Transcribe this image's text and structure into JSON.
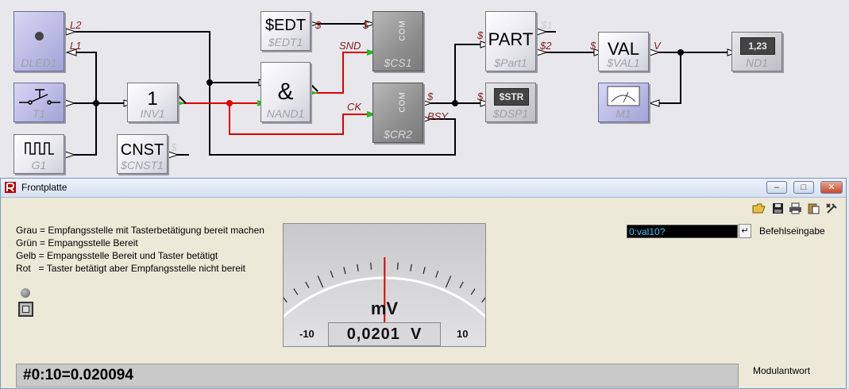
{
  "blocks": {
    "dled": {
      "name": "DLED1"
    },
    "t1": {
      "name": "T1"
    },
    "g1": {
      "name": "G1"
    },
    "inv": {
      "text": "1",
      "name": "INV1"
    },
    "cnst": {
      "text": "CNST",
      "name": "$CNST1"
    },
    "edt": {
      "text": "$EDT",
      "name": "$EDT1"
    },
    "nand": {
      "text": "&",
      "name": "NAND1"
    },
    "cs": {
      "text": "COM",
      "name": "$CS1"
    },
    "cr": {
      "text": "COM",
      "name": "$CR2"
    },
    "part": {
      "text": "PART",
      "name": "$Part1"
    },
    "dsp": {
      "text": "$STR",
      "name": "$DSP1"
    },
    "val": {
      "text": "VAL",
      "name": "$VAL1"
    },
    "m1": {
      "name": "M1"
    },
    "nd": {
      "text": "1,23",
      "name": "ND1"
    }
  },
  "ports": {
    "l2": "L2",
    "l1": "L1",
    "edt_out": "$",
    "cs_in": "$",
    "snd": "SND",
    "ck": "CK",
    "cr_out": "$",
    "bsy": "BSY",
    "part_in": "$",
    "dsp_in": "$",
    "p1": "$1",
    "p2": "$2",
    "val_in": "$",
    "val_out": "V",
    "cnst_out": "$"
  },
  "window": {
    "title": "Frontplatte"
  },
  "legend": [
    "Grau = Empfangsstelle mit Tasterbetätigung bereit machen",
    "Grün = Empangsstelle Bereit",
    "Gelb = Empangsstelle Bereit und Taster betätigt",
    "Rot   = Taster betätigt aber Empfangsstelle nicht bereit"
  ],
  "meter": {
    "unit": "mV",
    "min": "-10",
    "max": "10",
    "readout": "0,0201  V",
    "value": 0.0201
  },
  "command": {
    "value": "0:val10?",
    "label": "Befehlseingabe"
  },
  "response": {
    "value": "#0:10=0.020094",
    "label": "Modulantwort"
  },
  "colors": {
    "wire": "#000000",
    "active_wire": "#e00000",
    "port_active": "#22bb22"
  }
}
